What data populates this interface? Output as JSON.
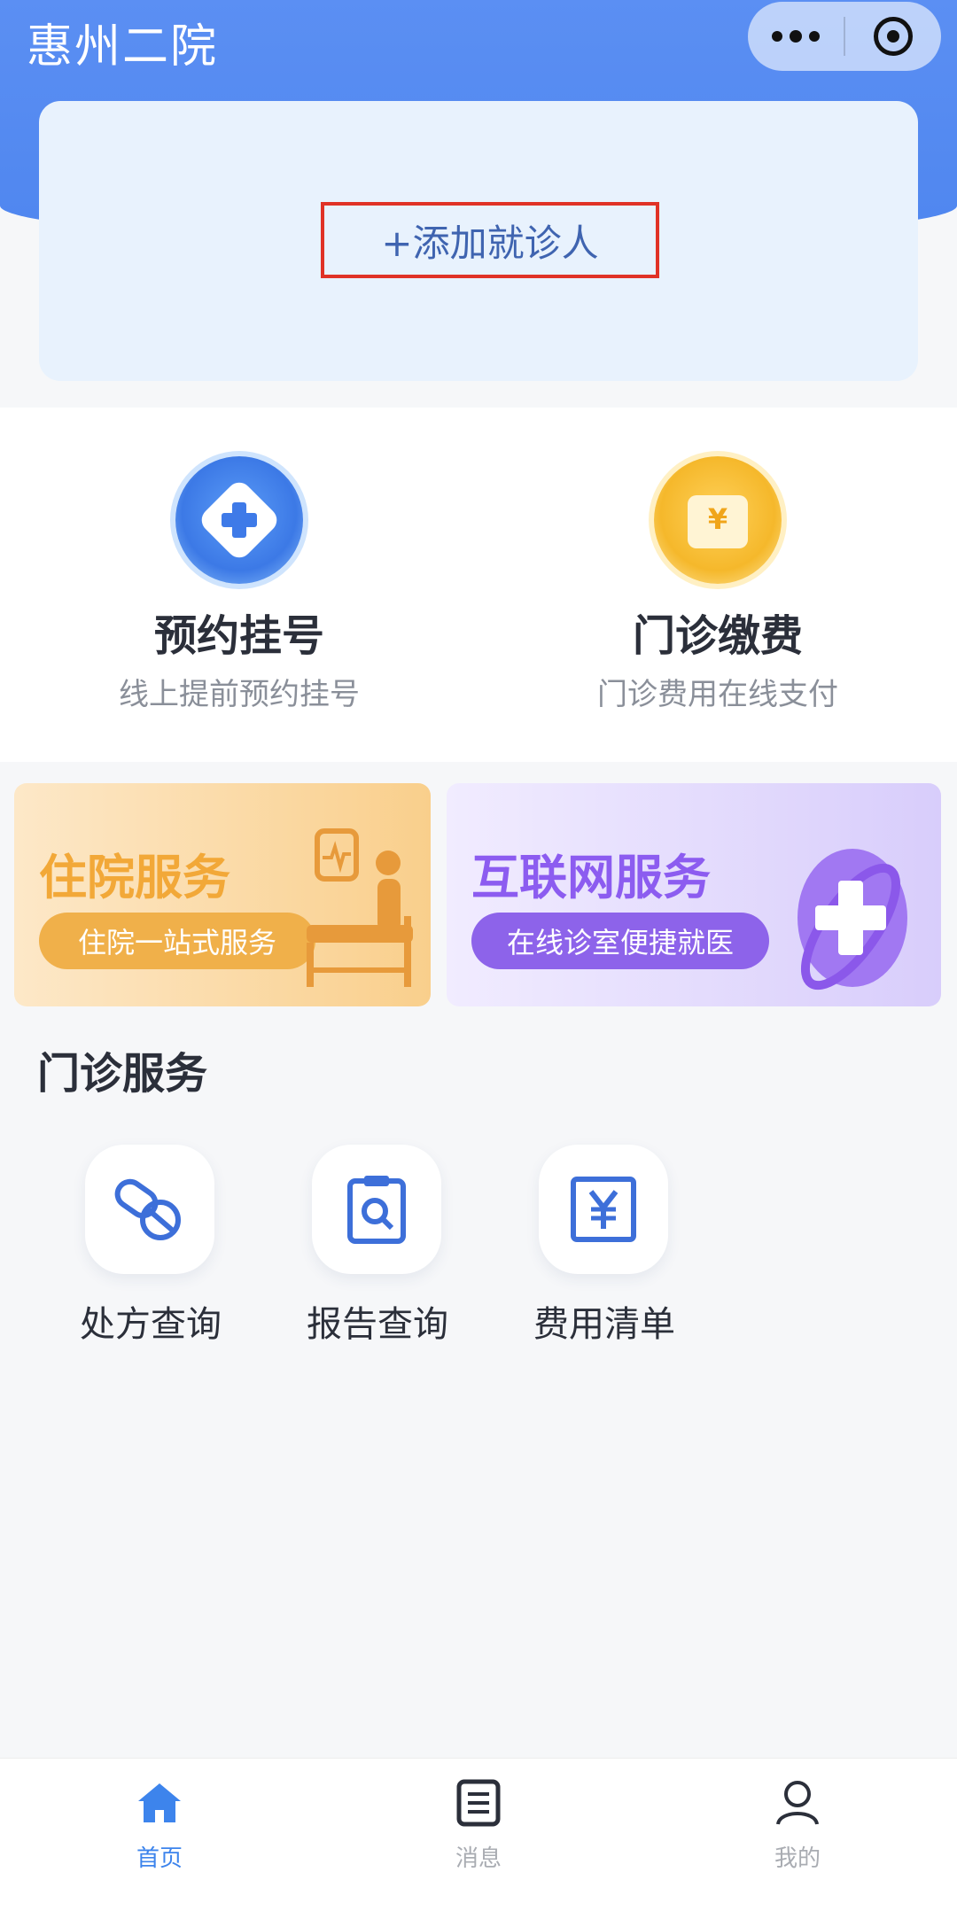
{
  "header": {
    "title": "惠州二院",
    "add_patient": "+添加就诊人"
  },
  "services": {
    "appointment": {
      "title": "预约挂号",
      "subtitle": "线上提前预约挂号"
    },
    "payment": {
      "title": "门诊缴费",
      "subtitle": "门诊费用在线支付"
    }
  },
  "banners": {
    "inpatient": {
      "title": "住院服务",
      "pill": "住院一站式服务"
    },
    "internet": {
      "title": "互联网服务",
      "pill": "在线诊室便捷就医"
    }
  },
  "outpatient": {
    "section_title": "门诊服务",
    "items": [
      {
        "label": "处方查询",
        "icon": "pill-icon"
      },
      {
        "label": "报告查询",
        "icon": "report-search-icon"
      },
      {
        "label": "费用清单",
        "icon": "yuan-bill-icon"
      }
    ]
  },
  "tabbar": {
    "items": [
      {
        "label": "首页",
        "icon": "home-icon",
        "active": true
      },
      {
        "label": "消息",
        "icon": "message-icon",
        "active": false
      },
      {
        "label": "我的",
        "icon": "user-icon",
        "active": false
      }
    ]
  },
  "colors": {
    "header": "#5b8ff3",
    "accent": "#3d84ec",
    "highlight_box": "#e03226",
    "inpatient": "#f2a838",
    "internet": "#8c5cf0"
  }
}
